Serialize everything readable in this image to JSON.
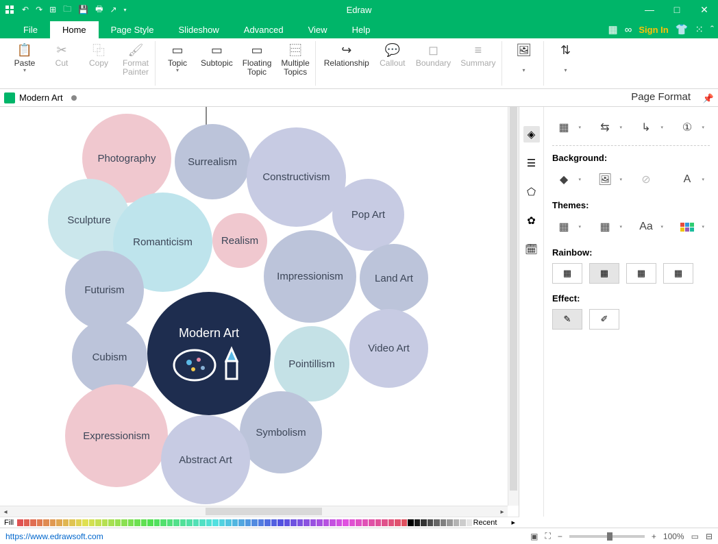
{
  "app": {
    "title": "Edraw"
  },
  "window": {
    "minimize": "—",
    "maximize": "□",
    "close": "✕"
  },
  "qat": {
    "undo": "↶",
    "redo": "↷",
    "new": "⊞",
    "open": "🗀",
    "save": "💾",
    "print": "🖶",
    "export": "↗"
  },
  "menu": {
    "file": "File",
    "home": "Home",
    "page": "Page Style",
    "slideshow": "Slideshow",
    "advanced": "Advanced",
    "view": "View",
    "help": "Help",
    "signin": "Sign In"
  },
  "ribbon": {
    "paste": "Paste",
    "cut": "Cut",
    "copy": "Copy",
    "format_painter": "Format\nPainter",
    "topic": "Topic",
    "subtopic": "Subtopic",
    "floating": "Floating\nTopic",
    "multiple": "Multiple\nTopics",
    "relationship": "Relationship",
    "callout": "Callout",
    "boundary": "Boundary",
    "summary": "Summary"
  },
  "doc": {
    "name": "Modern Art"
  },
  "mindmap": {
    "center": "Modern Art",
    "nodes": {
      "photography": "Photography",
      "surrealism": "Surrealism",
      "constructivism": "Constructivism",
      "sculpture": "Sculpture",
      "romanticism": "Romanticism",
      "realism": "Realism",
      "popart": "Pop Art",
      "futurism": "Futurism",
      "impressionism": "Impressionism",
      "landart": "Land Art",
      "cubism": "Cubism",
      "pointillism": "Pointillism",
      "videoart": "Video Art",
      "expressionism": "Expressionism",
      "symbolism": "Symbolism",
      "abstract": "Abstract Art"
    }
  },
  "panel": {
    "title": "Page Format",
    "background": "Background:",
    "themes": "Themes:",
    "rainbow": "Rainbow:",
    "effect": "Effect:"
  },
  "colorbar": {
    "fill": "Fill",
    "recent": "Recent"
  },
  "status": {
    "url": "https://www.edrawsoft.com",
    "zoom": "100%"
  }
}
